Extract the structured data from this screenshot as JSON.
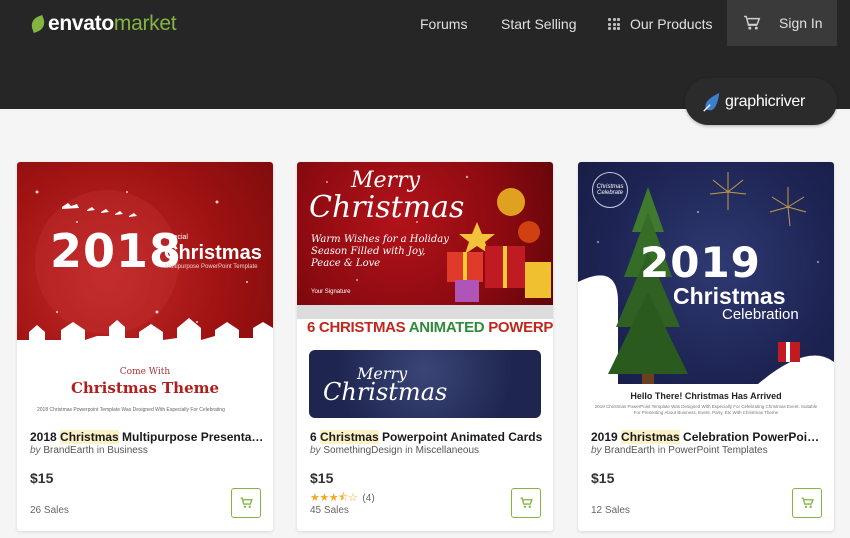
{
  "header": {
    "logo_primary": "envato",
    "logo_secondary": "market",
    "nav": {
      "forums": "Forums",
      "start_selling": "Start Selling",
      "our_products": "Our Products",
      "sign_in": "Sign In"
    },
    "badge": "graphicriver"
  },
  "colors": {
    "accent": "#82b541",
    "header_bg": "#262626",
    "highlight": "#fdf1c8"
  },
  "icons": [
    "leaf-icon",
    "grid-icon",
    "cart-icon",
    "graphicriver-drop-icon",
    "star-icon"
  ],
  "cards": [
    {
      "title_prefix": "2018 ",
      "title_highlight": "Christmas",
      "title_suffix": " Multipurpose Presentatio...",
      "by": "by",
      "author": "BrandEarth",
      "in": "in",
      "category": "Business",
      "price": "$15",
      "sales": "26 Sales",
      "thumb": {
        "year": "2018",
        "special": "Special",
        "heading": "Christmas",
        "subheading": "Multipurpose PowerPoint Template",
        "come_with": "Come With",
        "theme": "Christmas Theme",
        "caption": "2018 Christmas Powerpoint Template Was Designed With Especially For Celebrating"
      }
    },
    {
      "title_prefix": "6 ",
      "title_highlight": "Christmas",
      "title_suffix": " Powerpoint Animated Cards",
      "by": "by",
      "author": "SomethingDesign",
      "in": "in",
      "category": "Miscellaneous",
      "price": "$15",
      "rating_value": 3.5,
      "rating_count": "(4)",
      "sales": "45 Sales",
      "thumb": {
        "merry": "Merry",
        "christmas": "Christmas",
        "wishes": "Warm Wishes for a Holiday Season Filled with Joy, Peace & Love",
        "signature": "Your Signature",
        "banner_red_1": "6 CHRISTMAS ",
        "banner_green": "ANIMATED",
        "banner_red_2": " POWERPOINT CARDS",
        "merry_2": "Merry",
        "christmas_2": "Christmas"
      }
    },
    {
      "title_prefix": "2019 ",
      "title_highlight": "Christmas",
      "title_suffix": " Celebration PowerPoint T...",
      "by": "by",
      "author": "BrandEarth",
      "in": "in",
      "category": "PowerPoint Templates",
      "price": "$15",
      "sales": "12 Sales",
      "thumb": {
        "badge": "Christmas Celebrate",
        "year": "2019",
        "heading": "Christmas",
        "subheading": "Celebration",
        "hello": "Hello There! Christmas Has Arrived",
        "caption": "2019 Christmas PowerPoint Template Was Designed With Especially For Celebrating Christmas Event. Suitable For Presenting About Business, Event, Party, Etc With Christmas Theme"
      }
    }
  ]
}
